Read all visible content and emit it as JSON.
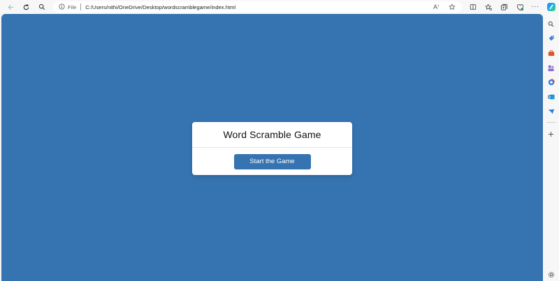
{
  "browser": {
    "address_bar": {
      "info_icon": "info-icon",
      "file_label": "File",
      "url": "C:/Users/nithi/OneDrive/Desktop/wordscramblegame/index.html"
    },
    "toolbar_icons": [
      "back-icon",
      "refresh-icon",
      "search-icon",
      "read-aloud-icon",
      "favorite-star-icon",
      "split-screen-icon",
      "favorites-icon",
      "collections-icon",
      "browser-essentials-icon",
      "more-icon",
      "copilot-icon"
    ],
    "read_aloud_label": "A⁾",
    "sidebar_icons": [
      "search-icon",
      "shopping-tag-icon",
      "tools-icon",
      "games-icon",
      "office-icon",
      "outlook-icon",
      "drop-icon",
      "add-icon",
      "settings-icon"
    ]
  },
  "page": {
    "background_color": "#3573b1",
    "card": {
      "title": "Word Scramble Game",
      "start_button_label": "Start the Game"
    }
  }
}
